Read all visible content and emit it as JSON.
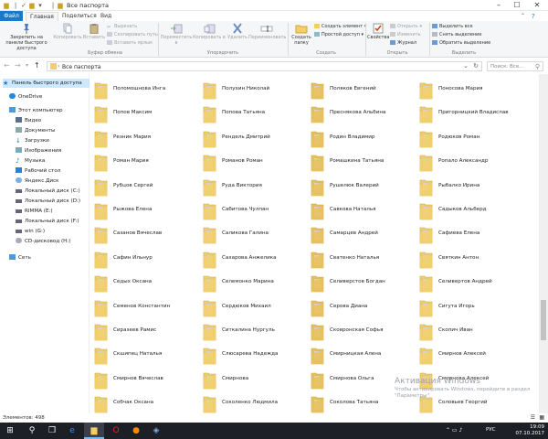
{
  "window": {
    "title": "Все паспорта"
  },
  "tabs": [
    "Файл",
    "Главная",
    "Поделиться",
    "Вид"
  ],
  "ribbon": {
    "pin": "Закрепить на панели быстрого доступа",
    "copy": "Копировать",
    "paste": "Вставить",
    "cut": "Вырезать",
    "copy_path": "Скопировать путь",
    "paste_shortcut": "Вставить ярлык",
    "clipboard_group": "Буфер обмена",
    "move_to": "Переместить в",
    "copy_to": "Копировать в",
    "delete": "Удалить",
    "rename": "Переименовать",
    "organize_group": "Упорядочить",
    "new_folder": "Создать папку",
    "new_item": "Создать элемент",
    "easy_access": "Простой доступ",
    "create_group": "Создать",
    "properties": "Свойства",
    "open": "Открыть",
    "edit": "Изменить",
    "history": "Журнал",
    "open_group": "Открыть",
    "select_all": "Выделить все",
    "select_none": "Снять выделение",
    "invert_selection": "Обратить выделение",
    "select_group": "Выделить"
  },
  "address": {
    "path": "Все паспорта",
    "separator": "›",
    "search_placeholder": "Поиск: Все..."
  },
  "nav": {
    "items": [
      {
        "label": "Панель быстрого доступа",
        "icon": "star-icon"
      },
      {
        "label": "OneDrive",
        "icon": "cloud-icon"
      },
      {
        "label": "Этот компьютер",
        "icon": "computer-icon"
      },
      {
        "label": "Видео",
        "icon": "video-folder-icon"
      },
      {
        "label": "Документы",
        "icon": "documents-folder-icon"
      },
      {
        "label": "Загрузки",
        "icon": "downloads-icon"
      },
      {
        "label": "Изображения",
        "icon": "pictures-folder-icon"
      },
      {
        "label": "Музыка",
        "icon": "music-icon"
      },
      {
        "label": "Рабочий стол",
        "icon": "desktop-folder-icon"
      },
      {
        "label": "Яндекс.Диск",
        "icon": "yandex-disk-icon"
      },
      {
        "label": "Локальный диск (C:)",
        "icon": "drive-icon"
      },
      {
        "label": "Локальный диск (D:)",
        "icon": "drive-icon"
      },
      {
        "label": "RIMMA (E:)",
        "icon": "drive-icon"
      },
      {
        "label": "Локальный диск (F:)",
        "icon": "drive-icon"
      },
      {
        "label": "win (G:)",
        "icon": "drive-icon"
      },
      {
        "label": "CD-дисковод (H:)",
        "icon": "cd-drive-icon"
      },
      {
        "label": "Сеть",
        "icon": "network-icon"
      }
    ]
  },
  "folders": [
    [
      "Поломошнова Инга",
      "Полухин Николай",
      "Поляков Евгений",
      "Поносова Мария"
    ],
    [
      "Попов Максим",
      "Попова Татьяна",
      "Преснякова Альбина",
      "Пригорницкий Владислав"
    ],
    [
      "Резник Мария",
      "Рендель Дмитрий",
      "Родин Владимир",
      "Родюков Роман"
    ],
    [
      "Роман Мария",
      "Романов Роман",
      "Ромашкина Татьяна",
      "Ропало Александр"
    ],
    [
      "Рубцов Сергей",
      "Руда Виктория",
      "Рушелюк Валерий",
      "Рыбалко Ирина"
    ],
    [
      "Рыжова Елена",
      "Сабитова Чулпан",
      "Савкова Наталья",
      "Садыков Альберд"
    ],
    [
      "Сазанов Вячеслав",
      "Саликова Галина",
      "Самарцев Андрей",
      "Сафиева Елена"
    ],
    [
      "Сафин Ильнур",
      "Сахарова Анжелика",
      "Сватенко Наталья",
      "Святкин Антон"
    ],
    [
      "Седых Оксана",
      "Селемонко Марина",
      "Селиверстов Богдан",
      "Селивертов Андрей"
    ],
    [
      "Семенов Константин",
      "Сердюков Михаил",
      "Серова Диана",
      "Сигута Игорь"
    ],
    [
      "Сиразеев Рамис",
      "Ситкалина Нургуль",
      "Сковронская Софья",
      "Скопич Иван"
    ],
    [
      "Скшипец Наталья",
      "Слюсарева Надежда",
      "Смирницкая Алена",
      "Смирнов Алексей"
    ],
    [
      "Смирнов Вячеслав",
      "Смирнова",
      "Смирнова Ольга",
      "Смирнова Алексей"
    ],
    [
      "Собчак Оксана",
      "Соколенко Людмила",
      "Соколова Татьяна",
      "Соловьев Георгий"
    ]
  ],
  "status": {
    "count": "Элементов: 498"
  },
  "watermark": {
    "title": "Активация Windows",
    "subtitle": "Чтобы активировать Windows, перейдите в раздел \"Параметры\"."
  },
  "taskbar": {
    "lang": "РУС",
    "time": "19:09",
    "date": "07.10.2017"
  },
  "colors": {
    "folder": "#f3cf6a",
    "accent": "#1979ca",
    "taskbar": "#1d1f26"
  }
}
